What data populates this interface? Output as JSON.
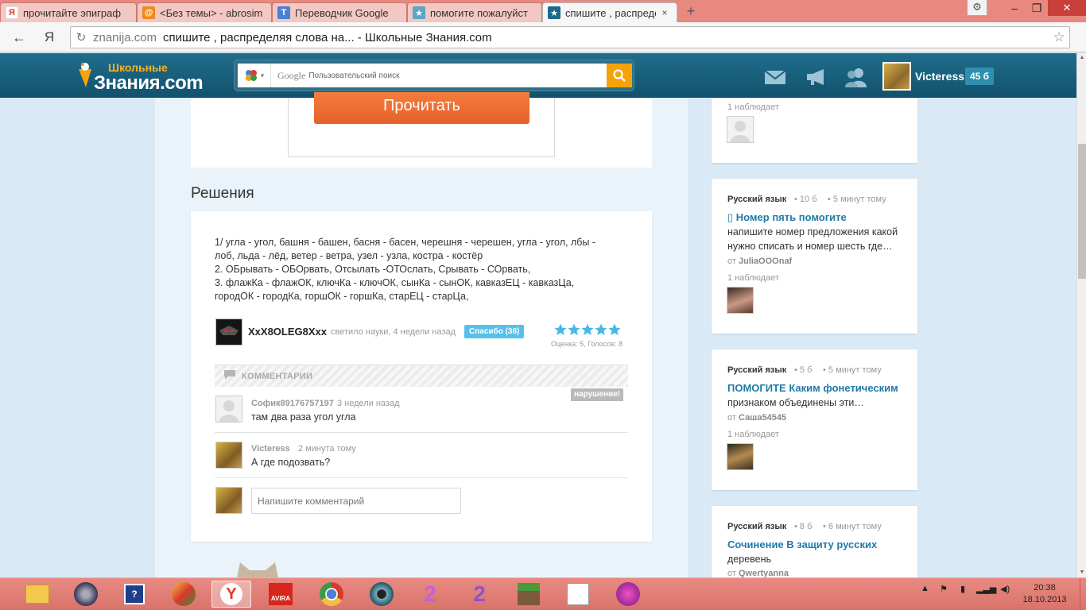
{
  "browser": {
    "tabs": [
      {
        "title": "прочитайте эпиграф",
        "favicon": "yandex-icon",
        "color": "#e23a2a"
      },
      {
        "title": "<Без темы> - abrosim",
        "favicon": "mail-icon",
        "color": "#f08a1c"
      },
      {
        "title": "Переводчик Google",
        "favicon": "translate-icon",
        "color": "#4a7fd6"
      },
      {
        "title": "помогите пожалуйст",
        "favicon": "znanija-icon",
        "color": "#f4a30b"
      },
      {
        "title": "спишите , распредел",
        "favicon": "znanija-icon",
        "color": "#1a6b8a"
      }
    ],
    "close_glyph": "×",
    "new_tab_glyph": "+",
    "address": {
      "domain": "znanija.com",
      "rest": "спишите , распределяя слова на... - Школьные Знания.com"
    }
  },
  "site": {
    "logo_small": "Школьные",
    "logo_big": "Знания.com",
    "search_brand": "Google",
    "search_placeholder": "Пользовательский поиск",
    "username": "Victeress",
    "points": "45 б"
  },
  "main": {
    "read_button": "Прочитать",
    "section_title": "Решения",
    "answer_lines": [
      "1/  угла - угол,  башня - башен, басня - басен, черешня - черешен, угла - угол, лбы -",
      "лоб, льда - лёд,  ветер - ветра,  узел - узла,  костра - костёр",
      "2.  ОБрывать - ОБОрвать,  Отсылать -ОТОслать,  Срывать - СОрвать,",
      "3.  флажКа - флажОК, ключКа - ключОК, сынКа - сынОК,  кавказЕЦ - кавказЦа,",
      "городОК - городКа, горшОК - горшКа,  старЕЦ - старЦа,"
    ],
    "answer_author": "XxX8OLEG8Xxx",
    "answer_meta": "светило науки, 4 недели назад",
    "thanks_label": "Спасибо (36)",
    "rating_text": "Оценка: 5, Голосов: 8",
    "rating_value": 5,
    "comments_label": "КОММЕНТАРИИ",
    "abuse_label": "нарушение!",
    "comments": [
      {
        "author": "Софик89176757197",
        "time": "3 недели назад",
        "text": "там два раза угол угла"
      },
      {
        "author": "Victeress",
        "time": "2 минута тому",
        "text": "А где подозвать?"
      }
    ],
    "comment_placeholder": "Напишите комментарий"
  },
  "sidebar": {
    "top_watch": "1 наблюдает",
    "questions": [
      {
        "subject": "Русский язык",
        "points": "10 б",
        "time": "5 минут тому",
        "title": "Номер пять помогите",
        "body": [
          "напишите номер предложения какой",
          "нужно списать и номер шесть где…"
        ],
        "from_prefix": "от",
        "author": "JuliaOOOnaf",
        "watch": "1 наблюдает"
      },
      {
        "subject": "Русский язык",
        "points": "5 б",
        "time": "5 минут тому",
        "title": "ПОМОГИТЕ Каким фонетическим",
        "body": [
          "признаком объединены эти…"
        ],
        "from_prefix": "от",
        "author": "Саша54545",
        "watch": "1 наблюдает"
      },
      {
        "subject": "Русский язык",
        "points": "8 б",
        "time": "6 минут тому",
        "title": "Сочинение  В защиту русских",
        "body": [
          "деревень"
        ],
        "from_prefix": "от",
        "author": "Qwertyanna",
        "watch": ""
      }
    ]
  },
  "taskbar": {
    "clock_time": "20:38",
    "clock_date": "18.10.2013",
    "colors": {
      "accent": "#1a6b8a",
      "orange": "#f4a30b",
      "link": "#1f7aa8"
    }
  }
}
